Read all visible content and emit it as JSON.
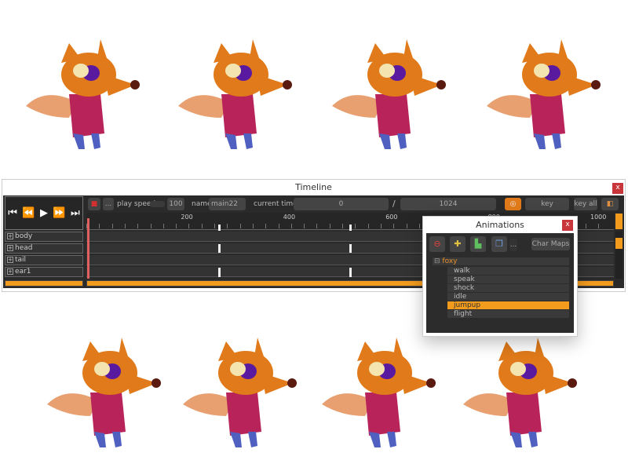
{
  "timeline": {
    "title": "Timeline",
    "close": "x",
    "transport_glyphs": [
      "⏮",
      "⏪",
      "▶",
      "⏩",
      "⏭"
    ],
    "more": "...",
    "play_speed_label": "play speed",
    "play_speed": "100",
    "name_label": "name",
    "name_value": "main22",
    "current_time_label": "current time:",
    "current_time": "0",
    "separator": "/",
    "end_time": "1024",
    "key_selected": "key selected",
    "key_all": "key all",
    "ruler_labels": [
      "200",
      "400",
      "600",
      "800",
      "1000"
    ],
    "ruler_values": [
      200,
      400,
      600,
      800,
      1000
    ],
    "keyframes": [
      0,
      258,
      512
    ],
    "tracks": [
      "body",
      "head",
      "tail",
      "ear1"
    ],
    "accent": "#f29b1d"
  },
  "animations": {
    "title": "Animations",
    "close": "x",
    "more": "...",
    "char_maps": "Char Maps",
    "root": "foxy",
    "items": [
      "walk",
      "speak",
      "shock",
      "idle",
      "jumpup",
      "flight"
    ],
    "selected": "jumpup"
  }
}
